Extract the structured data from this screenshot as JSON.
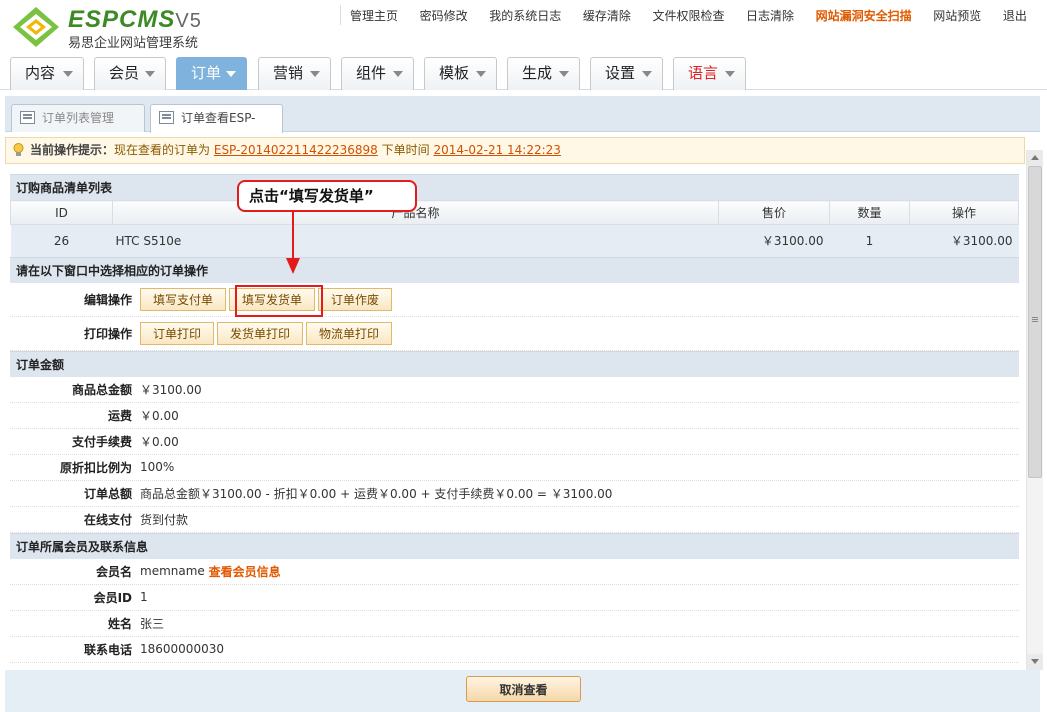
{
  "brand": {
    "logo_text": "ESPCMS",
    "logo_version": "V5",
    "tagline": "易思企业网站管理系统"
  },
  "topnav": [
    "管理主页",
    "密码修改",
    "我的系统日志",
    "缓存清除",
    "文件权限检查",
    "日志清除",
    "网站漏洞安全扫描",
    "网站预览",
    "退出"
  ],
  "mainnav": [
    "内容",
    "会员",
    "订单",
    "营销",
    "组件",
    "模板",
    "生成",
    "设置",
    "语言"
  ],
  "subtabs": [
    "订单列表管理",
    "订单查看ESP-"
  ],
  "tip": {
    "label": "当前操作提示：",
    "text1": "现在查看的订单为",
    "order_no": "ESP-201402211422236898",
    "text2": "下单时间",
    "time": "2014-02-21 14:22:23"
  },
  "items_section": {
    "title": "订购商品清单列表",
    "headers": [
      "ID",
      "产品名称",
      "售价",
      "数量",
      "操作"
    ],
    "rows": [
      {
        "id": "26",
        "name": "HTC S510e",
        "price": "￥3100.00",
        "qty": "1",
        "op": "￥3100.00"
      }
    ]
  },
  "ops_section": {
    "title": "请在以下窗口中选择相应的订单操作",
    "edit_label": "编辑操作",
    "edit_buttons": [
      "填写支付单",
      "填写发货单",
      "订单作废"
    ],
    "print_label": "打印操作",
    "print_buttons": [
      "订单打印",
      "发货单打印",
      "物流单打印"
    ]
  },
  "amount_section": {
    "title": "订单金额",
    "rows": [
      {
        "label": "商品总金额",
        "value": "￥3100.00"
      },
      {
        "label": "运费",
        "value": "￥0.00"
      },
      {
        "label": "支付手续费",
        "value": "￥0.00"
      },
      {
        "label": "原折扣比例为",
        "value": "100%"
      },
      {
        "label": "订单总额",
        "value": "商品总金额￥3100.00 - 折扣￥0.00 + 运费￥0.00 + 支付手续费￥0.00 = ￥3100.00"
      },
      {
        "label": "在线支付",
        "value": "货到付款"
      }
    ]
  },
  "member_section": {
    "title": "订单所属会员及联系信息",
    "rows": [
      {
        "label": "会员名",
        "value": "memname",
        "link": "查看会员信息"
      },
      {
        "label": "会员ID",
        "value": "1"
      },
      {
        "label": "姓名",
        "value": "张三"
      },
      {
        "label": "联系电话",
        "value": "18600000030"
      }
    ]
  },
  "annotation": {
    "callout": "点击“填写发货单”"
  },
  "footer": {
    "cancel": "取消查看"
  }
}
